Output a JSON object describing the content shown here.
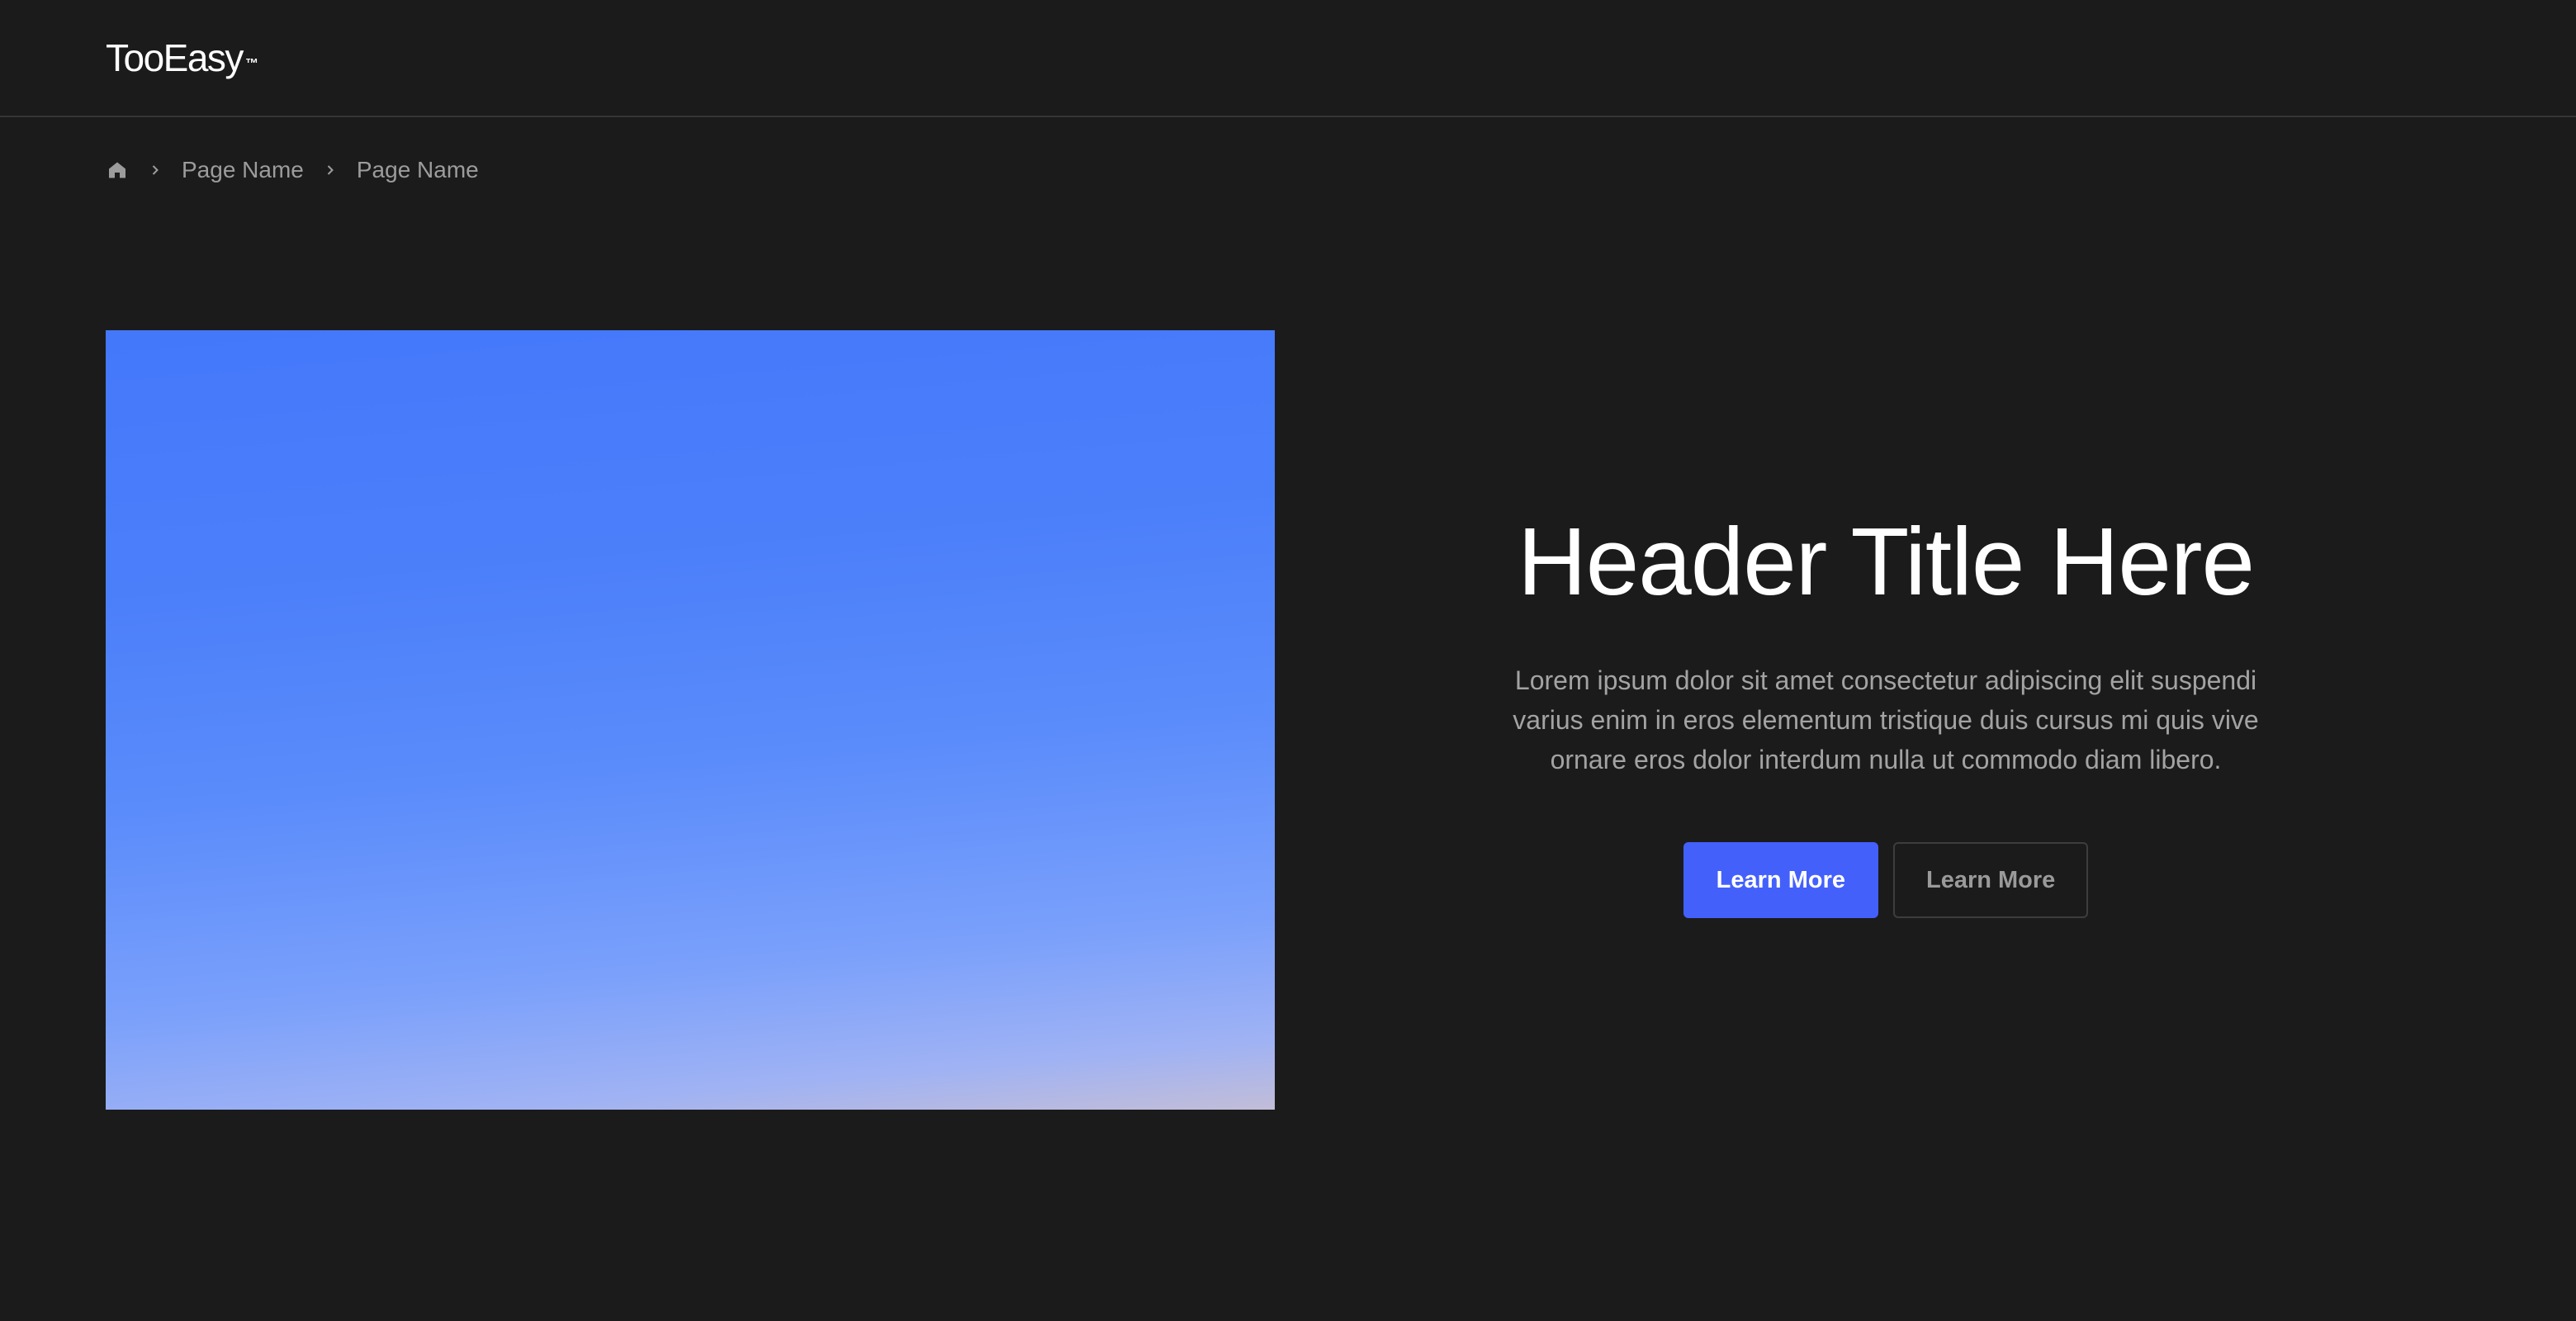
{
  "header": {
    "logo_text": "TooEasy",
    "logo_mark": "™"
  },
  "breadcrumb": {
    "home_icon": "home-icon",
    "separator_icon": "chevron-right-icon",
    "items": [
      {
        "label": "Page Name"
      },
      {
        "label": "Page Name"
      }
    ]
  },
  "hero": {
    "image_gradient": [
      "#4478fb",
      "#5b8cfb",
      "#7aa0fb",
      "#c2bdd8"
    ],
    "title": "Header Title Here",
    "body": "Lorem ipsum dolor sit amet consectetur adipiscing elit suspendi varius enim in eros elementum tristique duis cursus mi quis vive ornare eros dolor interdum nulla ut commodo diam libero.",
    "primary_button": {
      "label": "Learn More",
      "color": "#4460fb"
    },
    "secondary_button": {
      "label": "Learn More"
    }
  },
  "colors": {
    "background": "#1b1b1b",
    "divider": "#353535",
    "muted_text": "#9c9c9c"
  }
}
